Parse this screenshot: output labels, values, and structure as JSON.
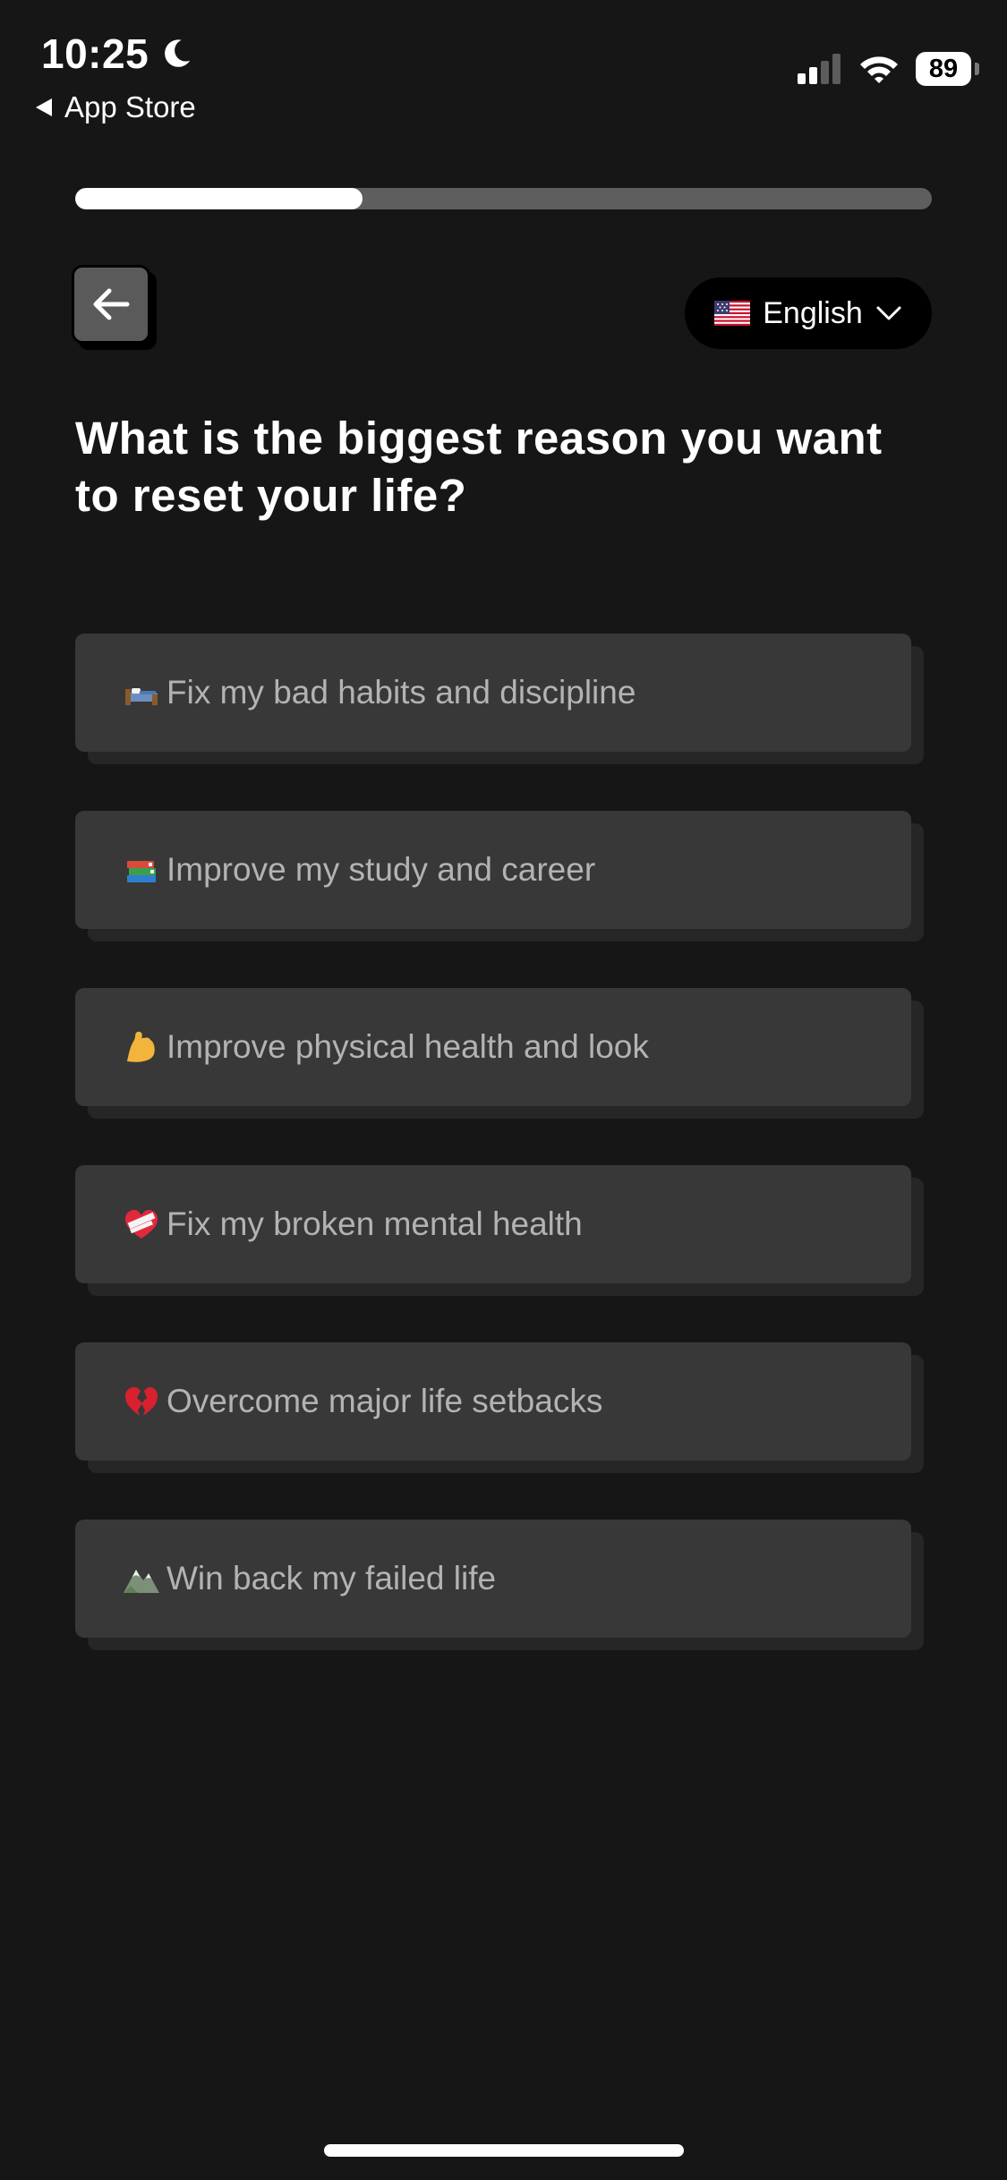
{
  "status_bar": {
    "time": "10:25",
    "back_app_label": "App Store",
    "battery": "89",
    "icons": [
      "moon-icon",
      "back-triangle-icon",
      "cellular-signal-icon",
      "wifi-icon",
      "battery-icon"
    ]
  },
  "progress": {
    "fraction": 0.335
  },
  "header": {
    "back_icon": "arrow-left-icon",
    "language": {
      "label": "English",
      "flag": "us-flag-icon",
      "dropdown_icon": "chevron-down-icon"
    }
  },
  "question": {
    "text": "What is the biggest reason you want to reset your life?"
  },
  "options": [
    {
      "label": "Fix my bad habits and discipline",
      "icon": "bed-icon"
    },
    {
      "label": "Improve my study and career",
      "icon": "books-icon"
    },
    {
      "label": "Improve physical health and look",
      "icon": "flexed-bicep-icon"
    },
    {
      "label": "Fix my broken mental health",
      "icon": "mending-heart-icon"
    },
    {
      "label": "Overcome major life setbacks",
      "icon": "broken-heart-icon"
    },
    {
      "label": "Win back my failed life",
      "icon": "mountain-icon"
    }
  ],
  "colors": {
    "background": "#161616",
    "option_bg": "#383838",
    "option_shadow": "#262626",
    "option_text": "#b3b3b3",
    "progress_track": "#5e5e5e",
    "progress_fill": "#ffffff"
  }
}
